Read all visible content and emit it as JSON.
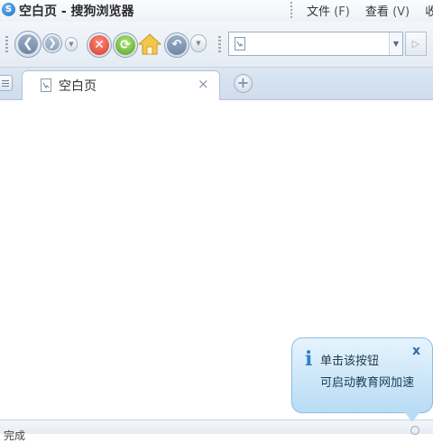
{
  "window": {
    "title": "空白页 - 搜狗浏览器",
    "logo_glyph": "S"
  },
  "menu": {
    "items": [
      {
        "label": "文件",
        "key": "(F)"
      },
      {
        "label": "查看",
        "key": "(V)"
      },
      {
        "label": "收藏",
        "key": ""
      }
    ]
  },
  "toolbar": {
    "back_glyph": "❮",
    "forward_glyph": "❯",
    "dropdown_glyph": "▼",
    "stop_glyph": "✕",
    "refresh_glyph": "⟳",
    "undo_glyph": "↶",
    "go_glyph": "▷"
  },
  "address": {
    "value": "",
    "placeholder": "",
    "dropdown_glyph": "▼"
  },
  "tabs": {
    "items": [
      {
        "label": "空白页",
        "close_glyph": "×"
      }
    ],
    "new_tab_glyph": "+"
  },
  "notification": {
    "line1": "单击该按钮",
    "line2": "可启动教育网加速",
    "close_glyph": "x",
    "info_glyph": "i"
  },
  "status": {
    "text": "完成"
  },
  "colors": {
    "accent": "#2d83c9",
    "bubble_bg": "#cfe8fa",
    "tabbar_bg": "#d6e3f1"
  }
}
